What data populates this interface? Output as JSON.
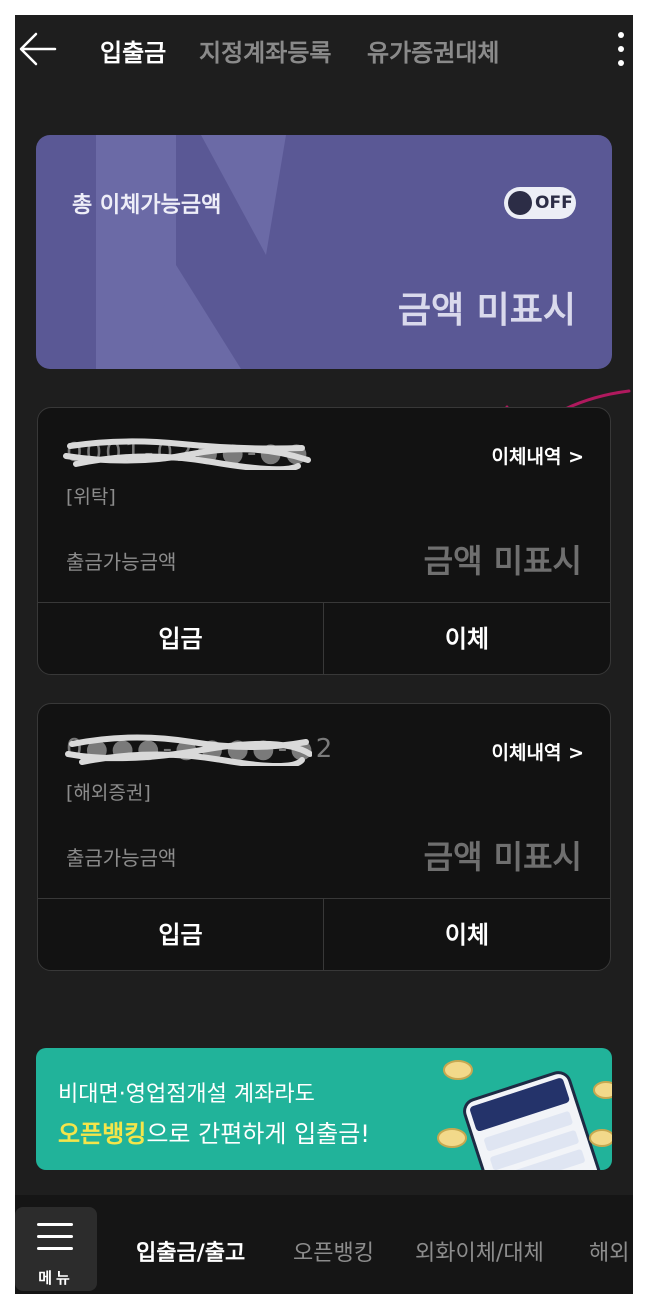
{
  "header": {
    "tabs": [
      {
        "label": "입출금",
        "active": true
      },
      {
        "label": "지정계좌등록",
        "active": false
      },
      {
        "label": "유가증권대체",
        "active": false
      }
    ]
  },
  "summary": {
    "title": "총 이체가능금액",
    "toggle_label": "OFF",
    "toggle_on": false,
    "amount_text": "금액 미표시"
  },
  "accounts": [
    {
      "number": "0001-02●●-●●",
      "history_label": "이체내역 >",
      "type": "[위탁]",
      "available_label": "출금가능금액",
      "available_amount": "금액 미표시",
      "deposit_label": "입금",
      "transfer_label": "이체"
    },
    {
      "number": "0●●●-●●●●-●2",
      "history_label": "이체내역 >",
      "type": "[해외증권]",
      "available_label": "출금가능금액",
      "available_amount": "금액 미표시",
      "deposit_label": "입금",
      "transfer_label": "이체"
    }
  ],
  "banner": {
    "line1": "비대면·영업점개설 계좌라도",
    "highlight": "오픈뱅킹",
    "line2_rest": "으로 간편하게 입출금!"
  },
  "bottom_nav": {
    "menu_label": "메뉴",
    "tabs": [
      {
        "label": "입출금/출고",
        "active": true
      },
      {
        "label": "오픈뱅킹",
        "active": false
      },
      {
        "label": "외화이체/대체",
        "active": false
      },
      {
        "label": "해외",
        "active": false
      }
    ]
  },
  "colors": {
    "background": "#1e1e1e",
    "summary_card": "#5a5895",
    "banner": "#21b39a",
    "highlight": "#f4e54a",
    "annotation": "#b0195e"
  }
}
